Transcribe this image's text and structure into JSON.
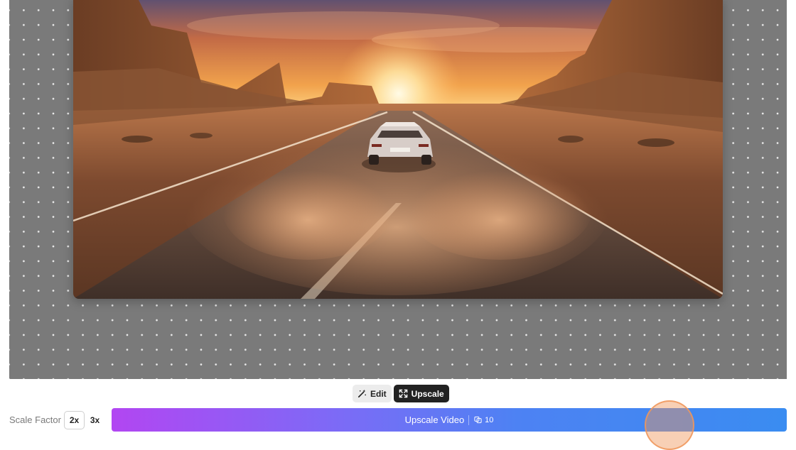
{
  "toolbar": {
    "edit_label": "Edit",
    "upscale_label": "Upscale",
    "edit_icon": "magic-wand-icon",
    "upscale_icon": "expand-icon"
  },
  "footer": {
    "scale_factor_label": "Scale Factor",
    "scale_options": [
      "2x",
      "3x"
    ],
    "selected_scale": "2x",
    "action_label": "Upscale Video",
    "credits": "10",
    "credits_icon": "credits-coins-icon"
  },
  "colors": {
    "gradient_start": "#b246f2",
    "gradient_end": "#3a8cf1",
    "active_toggle": "#222222",
    "canvas": "#7a7a7a"
  }
}
